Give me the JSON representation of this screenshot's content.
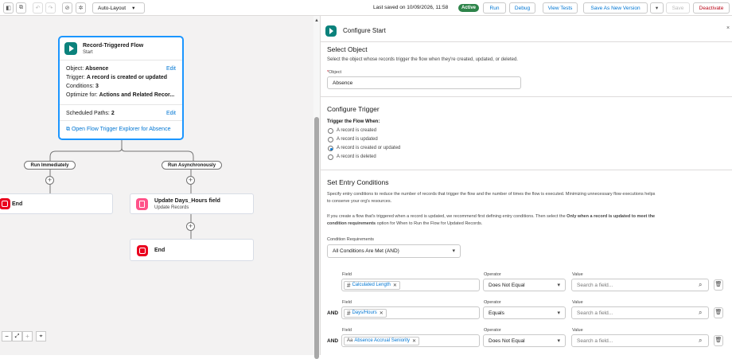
{
  "toolbar": {
    "layout_select": "Auto-Layout",
    "last_saved": "Last saved on 10/09/2026, 11:58",
    "status": "Active",
    "run": "Run",
    "debug": "Debug",
    "view_tests": "View Tests",
    "save_new_version": "Save As New Version",
    "save": "Save",
    "deactivate": "Deactivate"
  },
  "canvas": {
    "start": {
      "title": "Record-Triggered Flow",
      "subtitle": "Start",
      "object_label": "Object:",
      "object_value": "Absence",
      "edit1": "Edit",
      "trigger_label": "Trigger:",
      "trigger_value": "A record is created or updated",
      "conditions_label": "Conditions:",
      "conditions_value": "3",
      "optimize_label": "Optimize for:",
      "optimize_value": "Actions and Related Recor...",
      "scheduled_label": "Scheduled Paths:",
      "scheduled_value": "2",
      "edit2": "Edit",
      "explorer_link": "Open Flow Trigger Explorer for Absence"
    },
    "branch_left": "Run Immediately",
    "branch_right": "Run Asynchronously",
    "end_left": "End",
    "update_title": "Update Days_Hours field",
    "update_sub": "Update Records",
    "end_right": "End",
    "update_color": "#ff538a",
    "end_color": "#ea001e"
  },
  "panel": {
    "header": "Configure Start",
    "select_object": {
      "title": "Select Object",
      "desc": "Select the object whose records trigger the flow when they're created, updated, or deleted.",
      "field_label": "Object",
      "field_value": "Absence"
    },
    "trigger": {
      "title": "Configure Trigger",
      "label": "Trigger the Flow When:",
      "options": [
        "A record is created",
        "A record is updated",
        "A record is created or updated",
        "A record is deleted"
      ],
      "selected": "A record is created or updated"
    },
    "entry": {
      "title": "Set Entry Conditions",
      "desc1a": "Specify entry conditions to reduce the number of records that trigger the flow and the number of times the flow is executed. Minimizing unnecessary flow executions helps",
      "desc1b": "to conserve your org's resources.",
      "desc2a_pre": "If you create a flow that's triggered when a record is updated, we recommend first defining entry conditions. Then select the ",
      "desc2a_bold": "Only when a record is updated to meet the",
      "desc2b_bold": "condition requirements",
      "desc2b_post": " option for When to Run the Flow for Updated Records.",
      "req_label": "Condition Requirements",
      "req_value": "All Conditions Are Met (AND)",
      "field_h": "Field",
      "operator_h": "Operator",
      "value_h": "Value",
      "value_placeholder": "Search a field...",
      "and_label": "AND",
      "rows": [
        {
          "field": "Calculated Length",
          "icon": "#",
          "operator": "Does Not Equal"
        },
        {
          "field": "Days/Hours",
          "icon": "#",
          "operator": "Equals"
        },
        {
          "field": "Absence Accrual Seniority",
          "icon": "Aa",
          "operator": "Does Not Equal"
        }
      ]
    }
  }
}
